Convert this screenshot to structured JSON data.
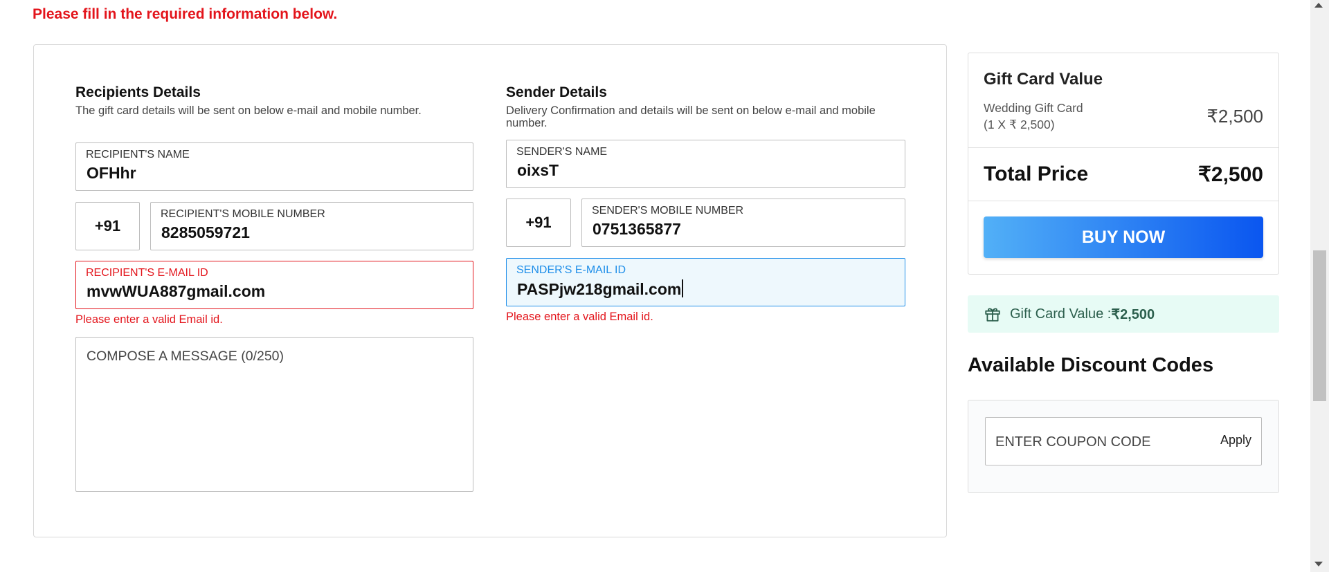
{
  "notice": "Please fill in the required information below.",
  "recipient": {
    "title": "Recipients Details",
    "subtitle": "The gift card details will be sent on below e-mail and mobile number.",
    "name_label": "RECIPIENT'S NAME",
    "name_value": "OFHhr",
    "country_code": "+91",
    "mobile_label": "RECIPIENT'S MOBILE NUMBER",
    "mobile_value": "8285059721",
    "email_label": "RECIPIENT'S E-MAIL ID",
    "email_value": "mvwWUA887gmail.com",
    "email_error": "Please enter a valid Email id.",
    "message_placeholder": "COMPOSE A MESSAGE (0/250)"
  },
  "sender": {
    "title": "Sender Details",
    "subtitle": "Delivery Confirmation and details will be sent on below e-mail and mobile number.",
    "name_label": "SENDER'S NAME",
    "name_value": "oixsT",
    "country_code": "+91",
    "mobile_label": "SENDER'S MOBILE NUMBER",
    "mobile_value": "0751365877",
    "email_label": "SENDER'S E-MAIL ID",
    "email_value": "PASPjw218gmail.com",
    "email_error": "Please enter a valid Email id."
  },
  "summary": {
    "title": "Gift Card Value",
    "item_name": "Wedding Gift Card",
    "item_qty": "(1 X ₹ 2,500)",
    "item_price": "₹2,500",
    "total_label": "Total Price",
    "total_value": "₹2,500",
    "buy_label": "BUY NOW"
  },
  "gift_value_bar": {
    "label": "Gift Card Value : ",
    "value": "₹2,500",
    "icon": "gift-icon"
  },
  "discount": {
    "title": "Available Discount Codes",
    "coupon_placeholder": "ENTER COUPON CODE",
    "apply_label": "Apply"
  },
  "colors": {
    "error": "#e3141b",
    "focus": "#1e8ee9",
    "buy_gradient_start": "#52b0f7",
    "buy_gradient_end": "#0a56f0",
    "gift_bar_bg": "#e7fbf5"
  }
}
